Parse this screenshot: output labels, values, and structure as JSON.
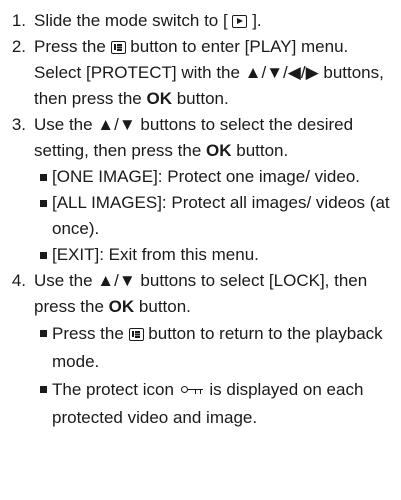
{
  "steps": [
    {
      "number": "1.",
      "text_before": "Slide the mode switch to [",
      "icon": "playback-mode-icon",
      "text_after": "]."
    },
    {
      "number": "2.",
      "text_a": "Press the",
      "icon": "menu-button-icon",
      "text_b": "button to enter [PLAY] menu. Select [PROTECT] with the ▲/▼/◀/▶ buttons, then press the",
      "bold": "OK",
      "text_c": "button."
    },
    {
      "number": "3.",
      "text_a": "Use the ▲/▼ buttons to select the desired setting, then press the",
      "bold": "OK",
      "text_b": "button.",
      "options": [
        "[ONE IMAGE]: Protect one image/ video.",
        "[ALL IMAGES]: Protect all images/ videos (at once).",
        "[EXIT]: Exit from this menu."
      ]
    },
    {
      "number": "4.",
      "text_a": "Use the ▲/▼ buttons to select [LOCK], then press the",
      "bold": "OK",
      "text_b": "button.",
      "notes": [
        {
          "before": "Press the",
          "icon": "menu-button-icon",
          "after": "button to return to the playback mode."
        },
        {
          "before": "The protect icon",
          "icon": "protect-key-icon",
          "after": "is displayed on each protected video and image."
        }
      ]
    }
  ]
}
